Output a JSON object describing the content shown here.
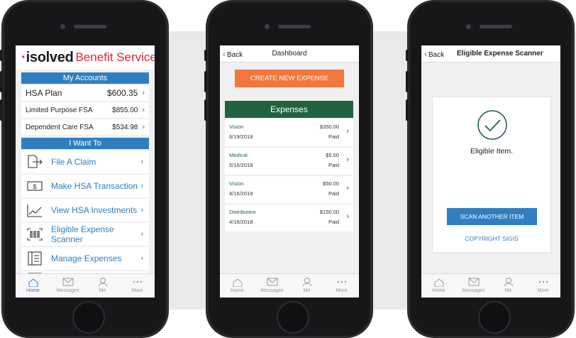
{
  "phone1": {
    "brand": {
      "mark": "·",
      "name": "isolved",
      "suffix": "Benefit Services"
    },
    "accounts_header": "My Accounts",
    "accounts": [
      {
        "name": "HSA Plan",
        "amount": "$600.35"
      },
      {
        "name": "Limited Purpose FSA",
        "amount": "$855.00"
      },
      {
        "name": "Dependent Care FSA",
        "amount": "$534.98"
      }
    ],
    "actions_header": "I Want To",
    "actions": [
      {
        "label": "File A Claim",
        "icon": "file-claim-icon"
      },
      {
        "label": "Make HSA Transaction",
        "icon": "dollar-bill-icon"
      },
      {
        "label": "View HSA Investments",
        "icon": "line-chart-icon"
      },
      {
        "label": "Eligible Expense Scanner",
        "icon": "barcode-icon"
      },
      {
        "label": "Manage Expenses",
        "icon": "list-icon"
      }
    ]
  },
  "phone2": {
    "nav": {
      "back_label": "Back",
      "title": "Dashboard"
    },
    "create_button": "CREATE NEW EXPENSE",
    "expenses_header": "Expenses",
    "expenses": [
      {
        "category": "Vision",
        "date": "6/19/2018",
        "amount": "$350.00",
        "status": "Paid"
      },
      {
        "category": "Medical",
        "date": "5/16/2018",
        "amount": "$5.00",
        "status": "Paid"
      },
      {
        "category": "Vision",
        "date": "4/16/2018",
        "amount": "$50.00",
        "status": "Paid"
      },
      {
        "category": "Distribution",
        "date": "4/16/2018",
        "amount": "$150.00",
        "status": "Paid"
      }
    ]
  },
  "phone3": {
    "nav": {
      "back_label": "Back",
      "title": "Eligible Expense Scanner"
    },
    "result_text": "Eligible Item.",
    "scan_button": "SCAN ANOTHER ITEM",
    "copyright": "COPYRIGHT SIGIS"
  },
  "tabbar": {
    "tabs": [
      {
        "label": "Home",
        "icon": "home-icon"
      },
      {
        "label": "Messages",
        "icon": "envelope-icon"
      },
      {
        "label": "Me",
        "icon": "person-icon"
      },
      {
        "label": "More",
        "icon": "ellipsis-icon"
      }
    ]
  },
  "colors": {
    "brand_blue": "#2f7fc0",
    "brand_red": "#e8242f",
    "expense_green": "#22633f",
    "create_orange": "#f3763d"
  }
}
